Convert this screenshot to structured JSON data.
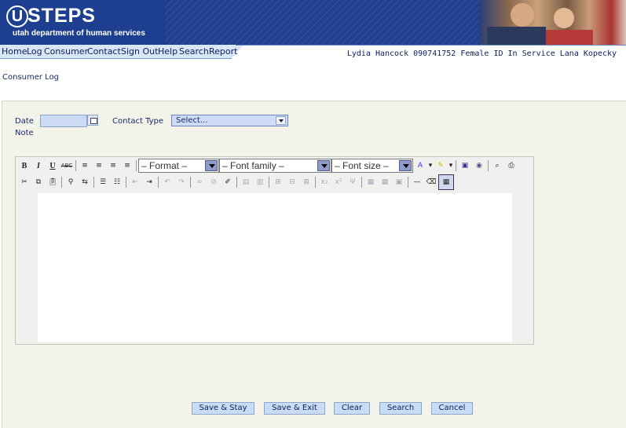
{
  "header": {
    "logo_u": "U",
    "logo_text": "STEPS",
    "logo_subtitle": "utah department of human services"
  },
  "nav": {
    "items": [
      "Home",
      "Log",
      "Consumer",
      "Contact",
      "Sign Out",
      "Help",
      "Search",
      "Report"
    ]
  },
  "consumer_info": "Lydia Hancock 090741752 Female ID In Service Lana Kopecky",
  "page_title": "Consumer Log",
  "form": {
    "date_label": "Date",
    "date_value": "",
    "contact_type_label": "Contact Type",
    "contact_type_value": "Select...",
    "note_label": "Note"
  },
  "editor": {
    "format_select": "– Format –",
    "font_family_select": "– Font family –",
    "font_size_select": "– Font size –",
    "content": ""
  },
  "buttons": {
    "save_stay": "Save & Stay",
    "save_exit": "Save & Exit",
    "clear": "Clear",
    "search": "Search",
    "cancel": "Cancel"
  },
  "colors": {
    "banner": "#1e3f8f",
    "panel": "#f3f3ea",
    "button_bg": "#c9dcf3",
    "input_bg": "#ccdaf3"
  }
}
